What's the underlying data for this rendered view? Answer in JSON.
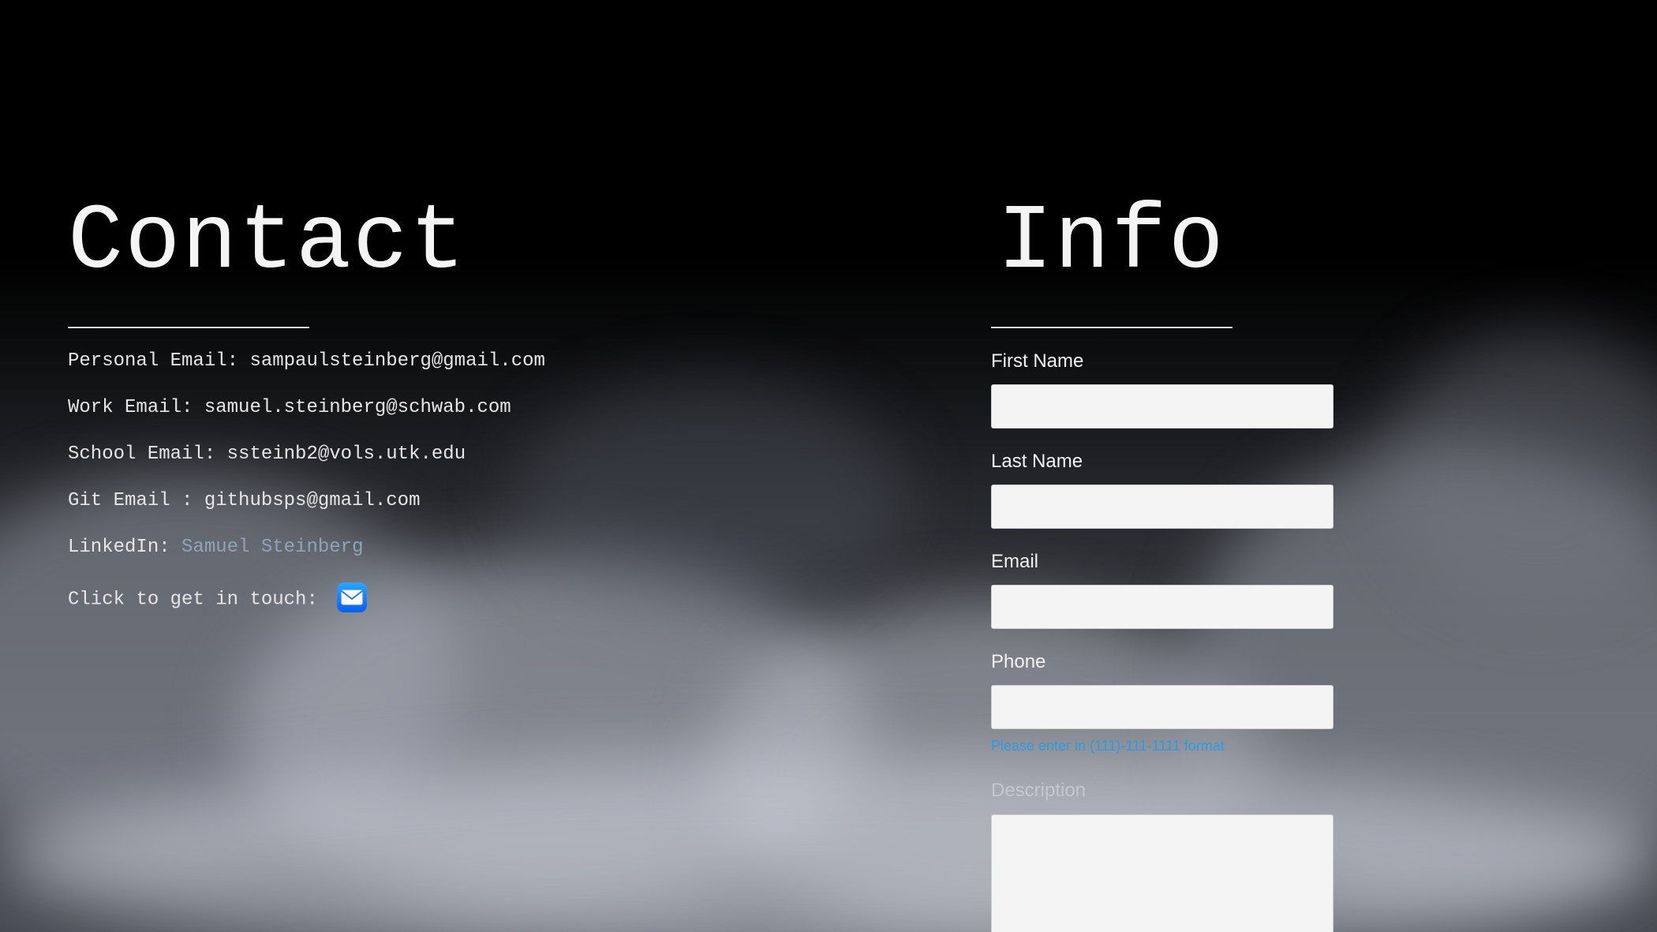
{
  "contact": {
    "heading": "Contact",
    "personal_email_label": "Personal Email: ",
    "personal_email": "sampaulsteinberg@gmail.com",
    "work_email_label": "Work Email: ",
    "work_email": "samuel.steinberg@schwab.com",
    "school_email_label": "School Email: ",
    "school_email": "ssteinb2@vols.utk.edu",
    "git_email_label": "Git Email : ",
    "git_email": "githubsps@gmail.com",
    "linkedin_label": "LinkedIn: ",
    "linkedin_link": "Samuel Steinberg",
    "touch_label": "Click to get in touch: ",
    "touch_icon": "mail-icon"
  },
  "info": {
    "heading": "Info",
    "first_name_label": "First Name",
    "first_name_value": "",
    "last_name_label": "Last Name",
    "last_name_value": "",
    "email_label": "Email",
    "email_value": "",
    "phone_label": "Phone",
    "phone_value": "",
    "phone_hint": "Please enter in (111)-111-1111 format",
    "description_label": "Description",
    "description_value": ""
  },
  "colors": {
    "background": "#000000",
    "text": "#f4f4f4",
    "link": "#8fa4b6",
    "hint": "#2e9be0",
    "field_bg": "#f4f4f4"
  }
}
